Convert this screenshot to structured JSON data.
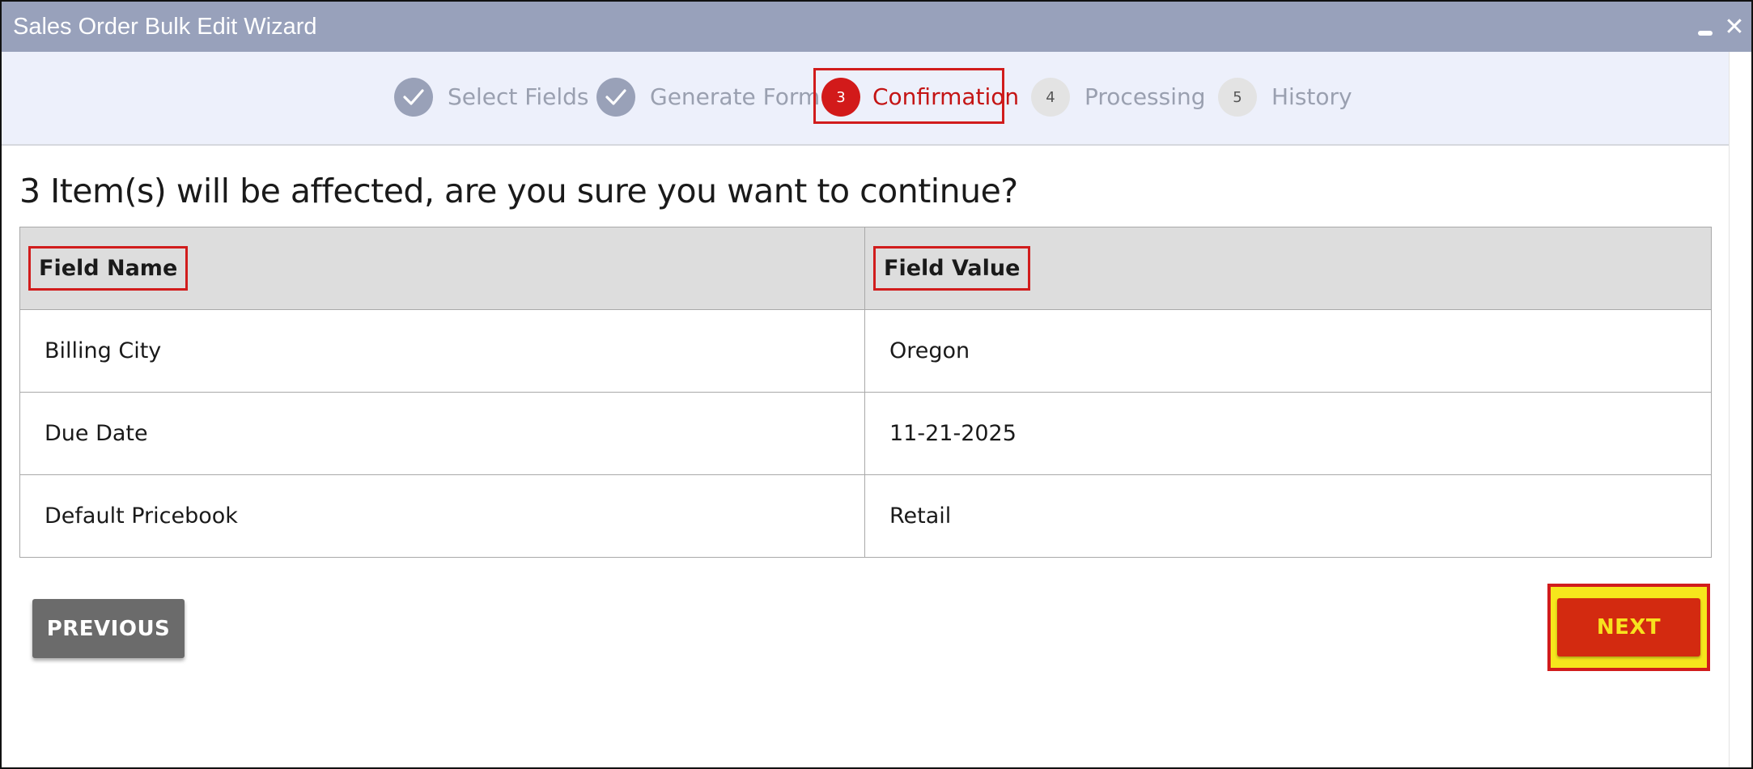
{
  "window": {
    "title": "Sales Order Bulk Edit Wizard",
    "minimize_glyph": "",
    "close_glyph": "✕"
  },
  "steps": [
    {
      "number": "1",
      "label": "Select Fields",
      "state": "completed",
      "icon": "check-icon"
    },
    {
      "number": "2",
      "label": "Generate Form",
      "state": "completed",
      "icon": "check-icon"
    },
    {
      "number": "3",
      "label": "Confirmation",
      "state": "active"
    },
    {
      "number": "4",
      "label": "Processing",
      "state": "pending"
    },
    {
      "number": "5",
      "label": "History",
      "state": "pending"
    }
  ],
  "confirmation": {
    "question": "3 Item(s) will be affected, are you sure you want to continue?"
  },
  "table": {
    "headers": [
      "Field Name",
      "Field Value"
    ],
    "rows": [
      [
        "Billing City",
        "Oregon"
      ],
      [
        "Due Date",
        "11-21-2025"
      ],
      [
        "Default Pricebook",
        "Retail"
      ]
    ]
  },
  "buttons": {
    "previous": "PREVIOUS",
    "next": "NEXT"
  },
  "colors": {
    "titlebar": "#98a1bb",
    "active_step": "#d21a1a",
    "highlight": "#d11c1c",
    "next_button": "#d32a10",
    "next_highlight": "#f6e61c",
    "previous_button": "#6b6b6b"
  }
}
